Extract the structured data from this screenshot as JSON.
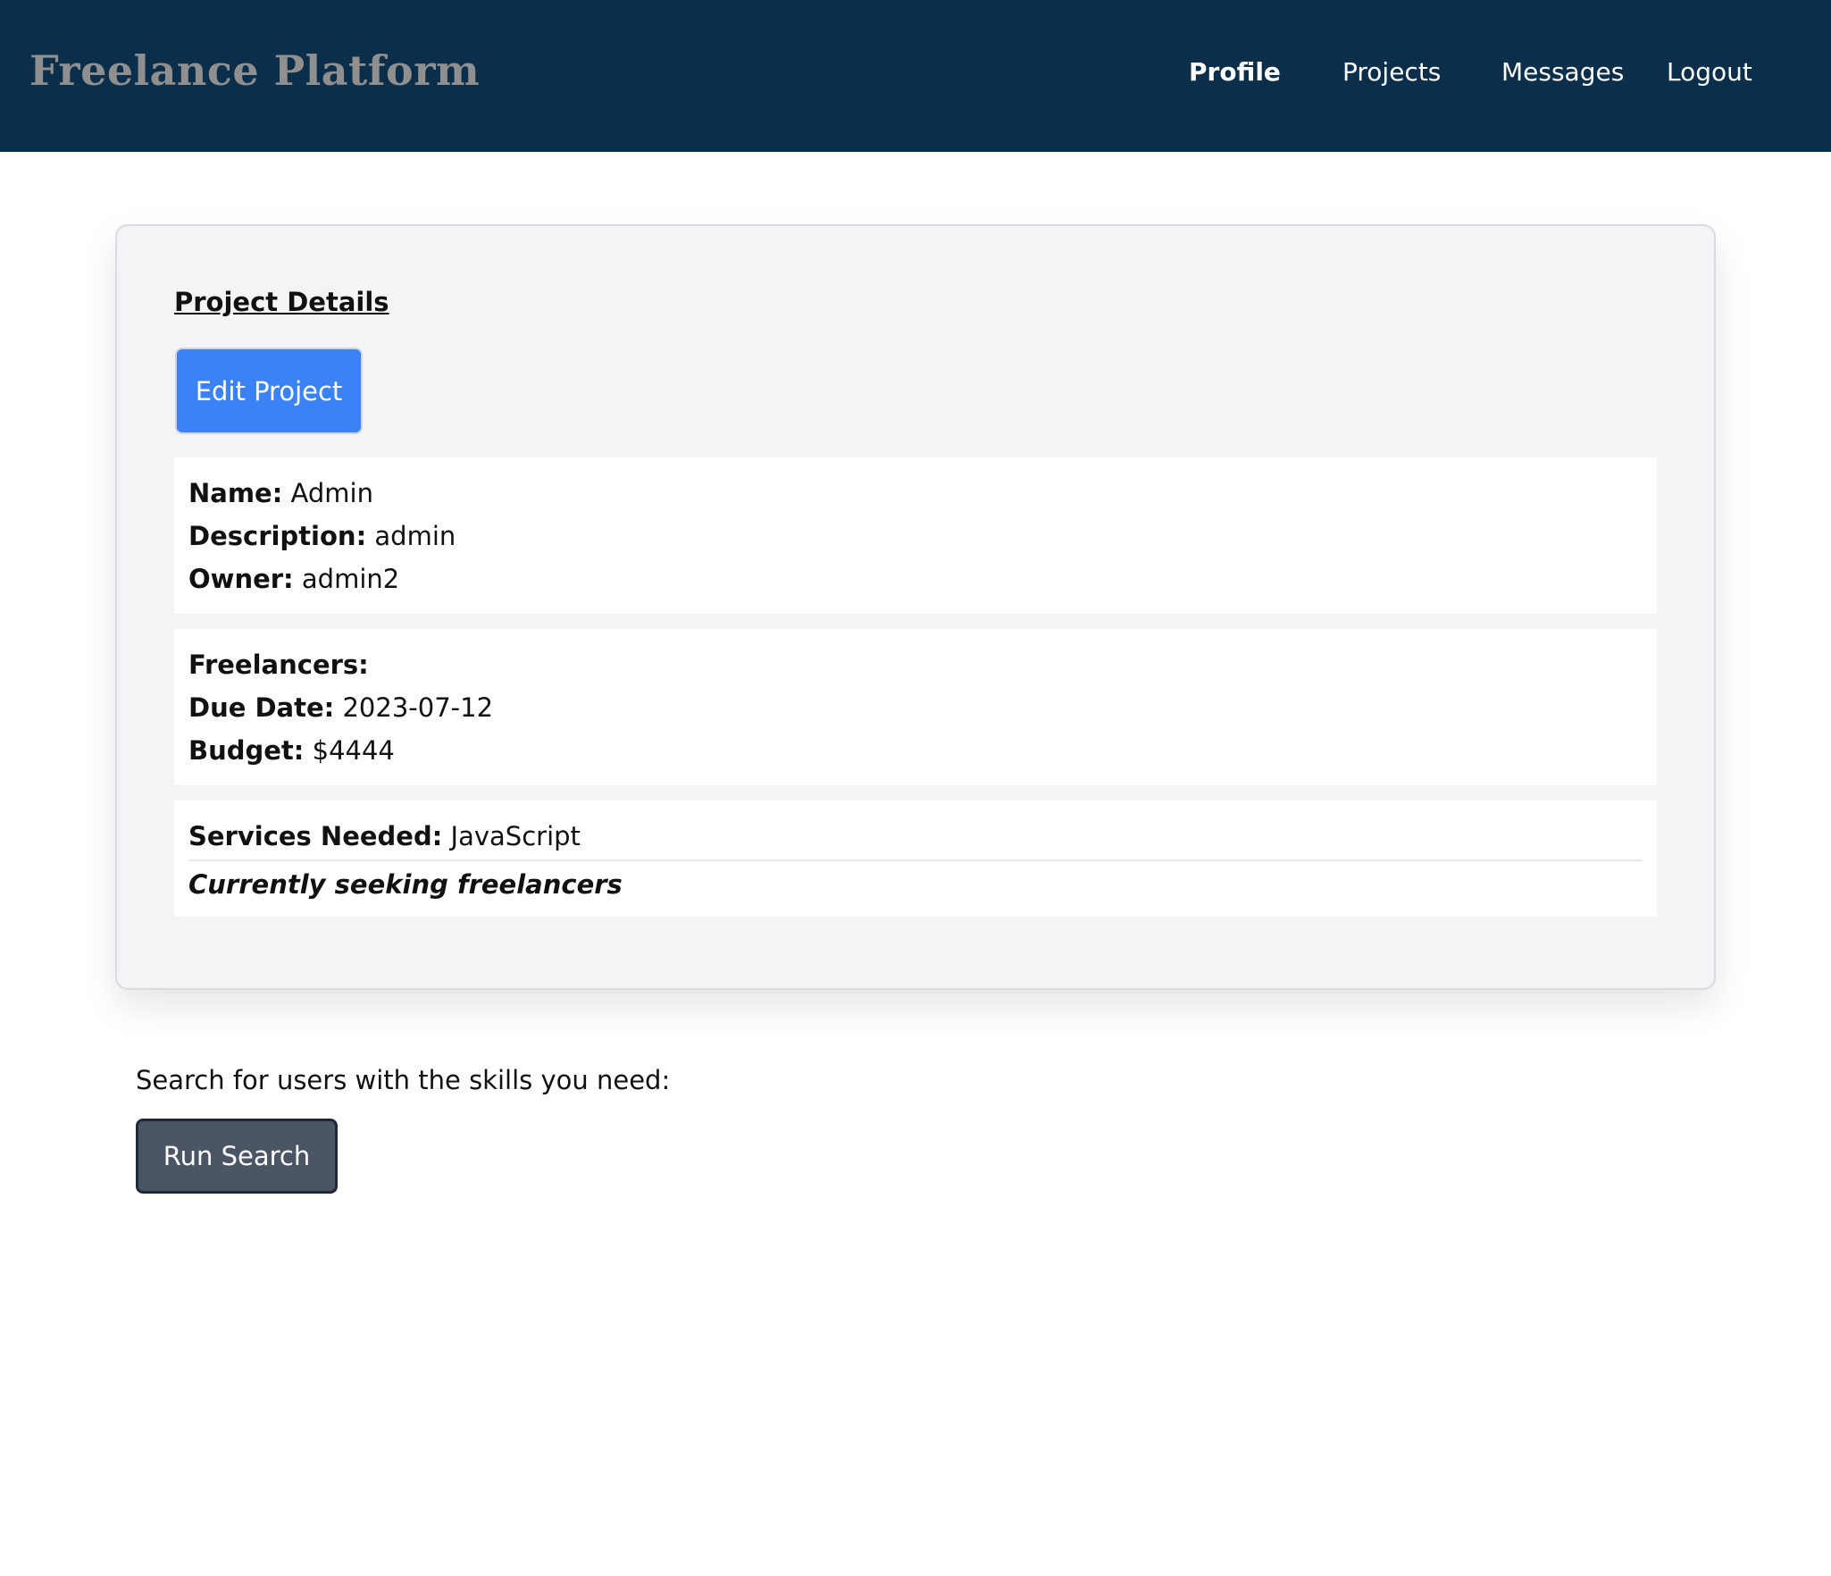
{
  "header": {
    "brand": "Freelance Platform",
    "nav": [
      {
        "label": "Profile",
        "active": true
      },
      {
        "label": "Projects",
        "active": false
      },
      {
        "label": "Messages",
        "active": false
      },
      {
        "label": "Logout",
        "active": false
      }
    ]
  },
  "project": {
    "heading": "Project Details",
    "edit_label": "Edit Project",
    "name_label": "Name:",
    "name": "Admin",
    "description_label": "Description:",
    "description": "admin",
    "owner_label": "Owner:",
    "owner": "admin2",
    "freelancers_label": "Freelancers:",
    "freelancers": "",
    "due_label": "Due Date:",
    "due_date": "2023-07-12",
    "budget_label": "Budget:",
    "budget": "$4444",
    "services_label": "Services Needed:",
    "services": "JavaScript",
    "status": "Currently seeking freelancers"
  },
  "search": {
    "prompt": "Search for users with the skills you need:",
    "button_label": "Run Search"
  },
  "colors": {
    "header": "#0b2f4b",
    "primary": "#3b82f6",
    "secondary": "#4b5563"
  }
}
